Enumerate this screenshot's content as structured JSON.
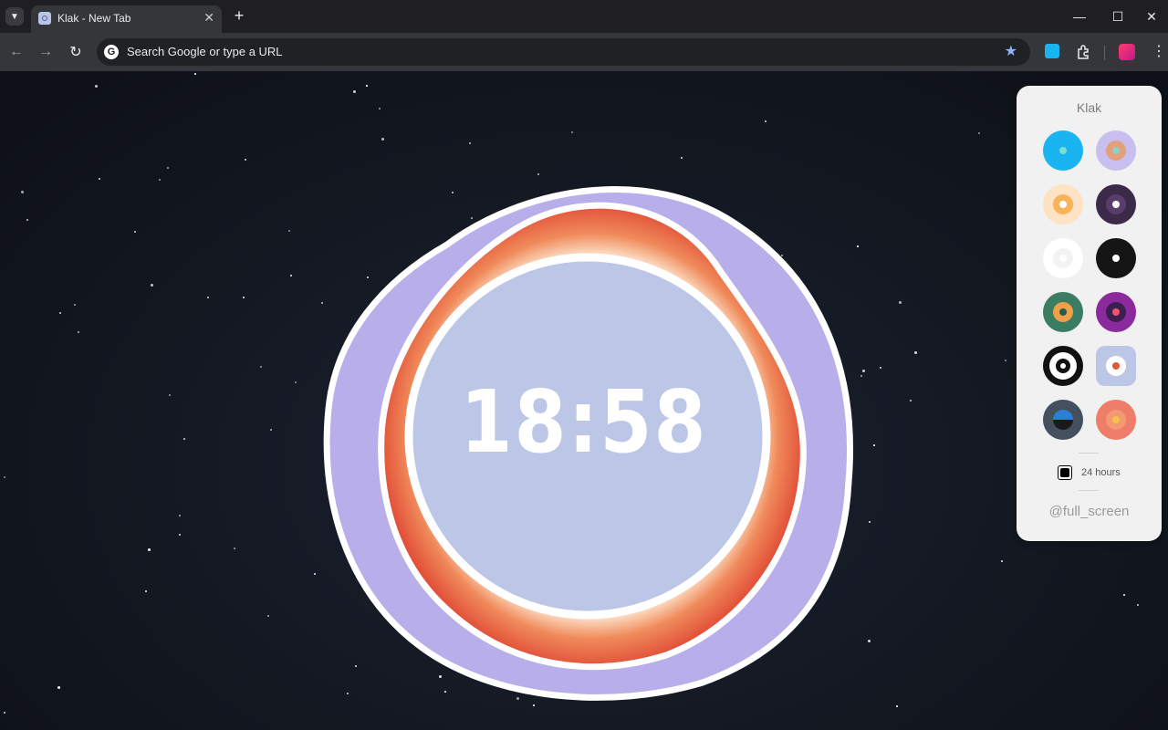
{
  "browser": {
    "tab_title": "Klak - New Tab",
    "tab_close": "✕",
    "new_tab": "+",
    "minimize": "—",
    "maximize": "☐",
    "close": "✕",
    "omnibox_placeholder": "Search Google or type a URL",
    "google_letter": "G"
  },
  "clock": {
    "time": "18:58",
    "colors": {
      "outer_blob": "#b8aeea",
      "rim": "#ffffff",
      "orange_ring": "#e8583a",
      "inner_face": "#bcc6e6"
    }
  },
  "panel": {
    "title": "Klak",
    "themes": [
      {
        "name": "theme-blue",
        "outer": "#1ab4f0",
        "mid": "#1ab4f0",
        "dot": "#7de0cf",
        "shape": "circle"
      },
      {
        "name": "theme-lavender",
        "outer": "#c9bfee",
        "mid": "#e4a07a",
        "dot": "#8fd0c0",
        "shape": "circle"
      },
      {
        "name": "theme-peach",
        "outer": "#fde3c4",
        "mid": "#f7b25a",
        "dot": "#ffffff",
        "shape": "circle"
      },
      {
        "name": "theme-plum",
        "outer": "#3b2a4a",
        "mid": "#5a3d6a",
        "dot": "#ffffff",
        "shape": "circle"
      },
      {
        "name": "theme-white",
        "outer": "#ffffff",
        "mid": "#f3f3f3",
        "dot": "#ffffff",
        "shape": "circle"
      },
      {
        "name": "theme-black",
        "outer": "#151515",
        "mid": "#151515",
        "dot": "#ffffff",
        "shape": "circle"
      },
      {
        "name": "theme-green",
        "outer": "#3a7d63",
        "mid": "#f1a04a",
        "dot": "#2b5a48",
        "shape": "circle"
      },
      {
        "name": "theme-purple",
        "outer": "#8a2a9c",
        "mid": "#3b1f4f",
        "dot": "#f0546c",
        "shape": "circle"
      },
      {
        "name": "theme-target",
        "outer": "#111111",
        "mid": "#ffffff",
        "dot": "#111111",
        "shape": "circle"
      },
      {
        "name": "theme-periwinkle",
        "outer": "#bcc6e6",
        "mid": "#ffffff",
        "dot": "#e05a3a",
        "shape": "rounded"
      },
      {
        "name": "theme-slate",
        "outer": "#44505e",
        "mid": "#2b7fd6",
        "dot": "#1a1a1a",
        "shape": "circle"
      },
      {
        "name": "theme-coral",
        "outer": "#ee7e6a",
        "mid": "#f39a72",
        "dot": "#f9c04e",
        "shape": "circle"
      }
    ],
    "toggle_label": "24 hours",
    "fullscreen_link": "@full_screen"
  }
}
